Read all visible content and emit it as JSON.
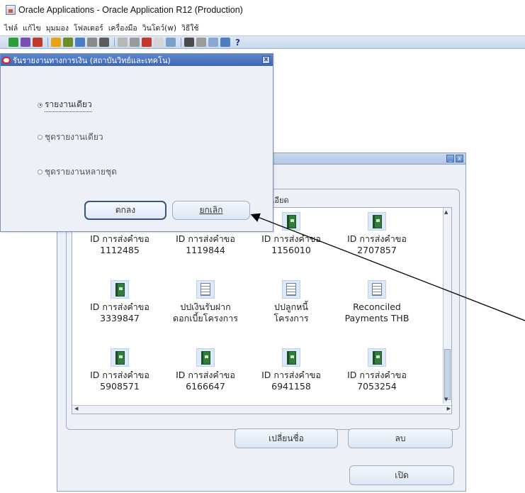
{
  "app": {
    "title": "Oracle Applications - Oracle Application R12 (Production)"
  },
  "menu": [
    "ไฟล์",
    "แก้ไข",
    "มุมมอง",
    "โฟลเดอร์",
    "เครื่องมือ",
    "วินโดว์(w)",
    "วิธีใช้"
  ],
  "toolbar": {
    "help_glyph": "?",
    "colors": [
      "#2e9e3a",
      "#7a4fb0",
      "#c0392b",
      "#e8a21a",
      "#6b8e23",
      "#4a7fc1",
      "#8a8a8a",
      "#5c5c5c",
      "#b7b7b7",
      "#9a9a9a",
      "#c0392b",
      "#d6d6d6",
      "#7d9ec9",
      "#4b4b4b",
      "#9b9b9b",
      "#8aa7cf",
      "#4a7fc1"
    ]
  },
  "dialog": {
    "title": "รันรายงานทางการเงิน (สถาบันวิทย์และเทคโน)",
    "close_glyph": "x",
    "options": [
      {
        "label": "รายงานเดียว",
        "selected": true
      },
      {
        "label": "ชุดรายงานเดียว",
        "selected": false
      },
      {
        "label": "ชุดรายงานหลายชุด",
        "selected": false
      }
    ],
    "ok_label": "ตกลง",
    "cancel_label": "ยกเลิก"
  },
  "navigator": {
    "min_glyph": "_",
    "close_glyph": "x",
    "group_label": "ละเอียด",
    "items": [
      {
        "line1": "ID การส่งคำขอ",
        "line2": "1112485",
        "icon": "book-icon"
      },
      {
        "line1": "ID การส่งคำขอ",
        "line2": "1119844",
        "icon": "book-icon"
      },
      {
        "line1": "ID การส่งคำขอ",
        "line2": "1156010",
        "icon": "book-icon"
      },
      {
        "line1": "ID การส่งคำขอ",
        "line2": "2707857",
        "icon": "book-icon"
      },
      {
        "line1": "ID การส่งคำขอ",
        "line2": "3339847",
        "icon": "book-icon"
      },
      {
        "line1": "ปปเงินรับฝาก",
        "line2": "ดอกเบี้ยโครงการ",
        "icon": "document-icon"
      },
      {
        "line1": "ปปลูกหนี้",
        "line2": "โครงการ",
        "icon": "document-icon"
      },
      {
        "line1": "Reconciled",
        "line2": "Payments THB",
        "icon": "document-icon"
      },
      {
        "line1": "ID การส่งคำขอ",
        "line2": "5908571",
        "icon": "book-icon"
      },
      {
        "line1": "ID การส่งคำขอ",
        "line2": "6166647",
        "icon": "book-icon"
      },
      {
        "line1": "ID การส่งคำขอ",
        "line2": "6941158",
        "icon": "book-icon"
      },
      {
        "line1": "ID การส่งคำขอ",
        "line2": "7053254",
        "icon": "book-icon"
      }
    ],
    "rename_label": "เปลี่ยนชื่อ",
    "delete_label": "ลบ",
    "open_label": "เปิด"
  }
}
